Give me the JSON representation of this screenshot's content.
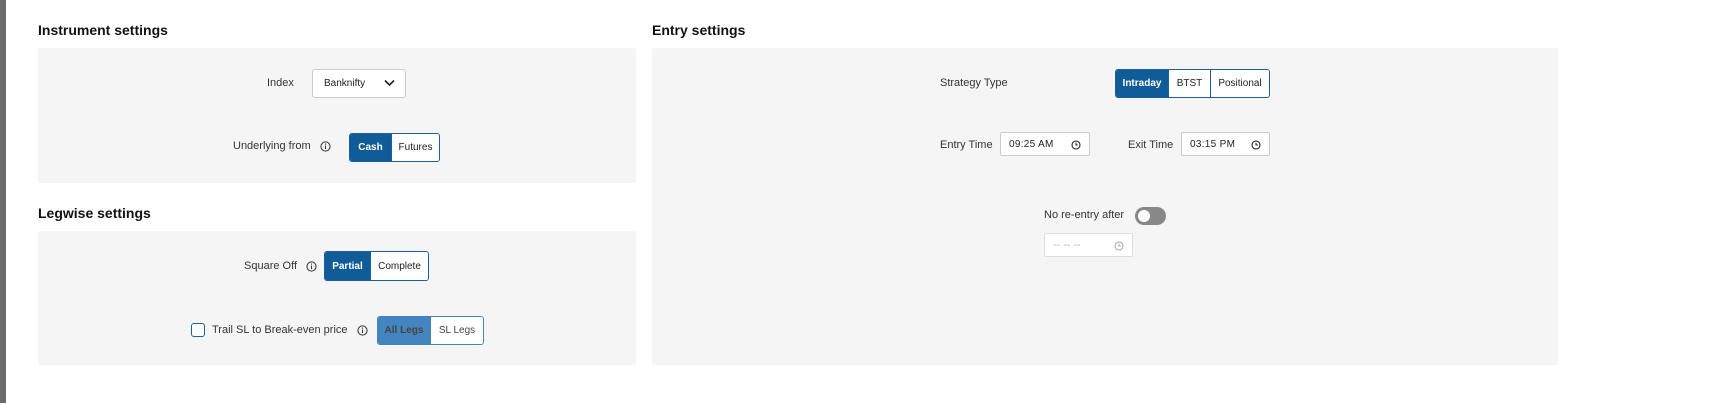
{
  "instrument": {
    "title": "Instrument settings",
    "index_label": "Index",
    "index_value": "Banknifty",
    "underlying_label": "Underlying from",
    "underlying_options": [
      "Cash",
      "Futures"
    ],
    "underlying_selected": "Cash"
  },
  "legwise": {
    "title": "Legwise settings",
    "square_off_label": "Square Off",
    "square_off_options": [
      "Partial",
      "Complete"
    ],
    "square_off_selected": "Partial",
    "trail_label": "Trail SL to Break-even price",
    "trail_checked": false,
    "trail_options": [
      "All Legs",
      "SL Legs"
    ],
    "trail_selected": "All Legs"
  },
  "entry": {
    "title": "Entry settings",
    "strategy_label": "Strategy Type",
    "strategy_options": [
      "Intraday",
      "BTST",
      "Positional"
    ],
    "strategy_selected": "Intraday",
    "entry_time_label": "Entry Time",
    "entry_time_value": "09:25 AM",
    "exit_time_label": "Exit Time",
    "exit_time_value": "03:15 PM",
    "no_reentry_label": "No re-entry after",
    "no_reentry_enabled": false,
    "no_reentry_time_placeholder": "-- -- --"
  },
  "colors": {
    "accent": "#0f5c99",
    "accent_light": "#4585bf",
    "panel_bg": "#f5f5f5"
  },
  "icons": [
    "info-icon",
    "chevron-down-icon",
    "clock-icon"
  ]
}
